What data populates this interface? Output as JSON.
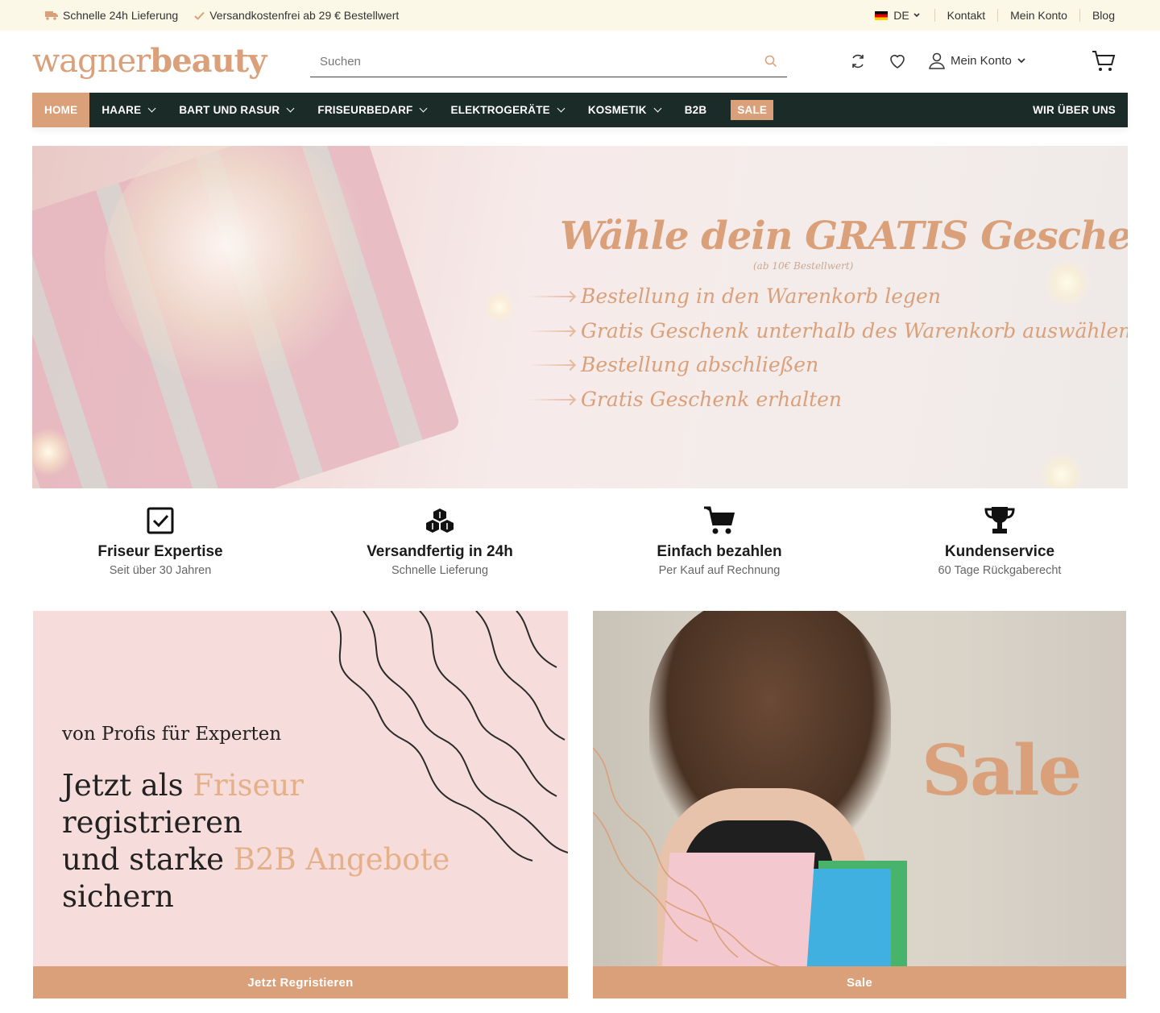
{
  "topbar": {
    "shipping_fast": "Schnelle 24h Lieferung",
    "shipping_free": "Versandkostenfrei ab 29 € Bestellwert",
    "language": "DE",
    "links": [
      "Kontakt",
      "Mein Konto",
      "Blog"
    ]
  },
  "header": {
    "logo_light": "wagner",
    "logo_bold": "beauty",
    "search_placeholder": "Suchen",
    "account_label": "Mein Konto"
  },
  "nav": {
    "items": [
      {
        "label": "HOME",
        "dropdown": false
      },
      {
        "label": "HAARE",
        "dropdown": true
      },
      {
        "label": "BART UND RASUR",
        "dropdown": true
      },
      {
        "label": "FRISEURBEDARF",
        "dropdown": true
      },
      {
        "label": "ELEKTROGERÄTE",
        "dropdown": true
      },
      {
        "label": "KOSMETIK",
        "dropdown": true
      },
      {
        "label": "B2B",
        "dropdown": false
      },
      {
        "label": "SALE",
        "dropdown": false
      }
    ],
    "right_item": "WIR ÜBER UNS"
  },
  "hero": {
    "title": "Wähle dein GRATIS Geschenk",
    "subtitle": "(ab 10€ Bestellwert)",
    "steps": [
      "Bestellung in den Warenkorb legen",
      "Gratis Geschenk unterhalb des Warenkorb auswählen",
      "Bestellung abschließen",
      "Gratis Geschenk erhalten"
    ]
  },
  "features": [
    {
      "icon": "checkbox-icon",
      "title": "Friseur Expertise",
      "subtitle": "Seit über 30 Jahren"
    },
    {
      "icon": "boxes-icon",
      "title": "Versandfertig in 24h",
      "subtitle": "Schnelle Lieferung"
    },
    {
      "icon": "cart-icon",
      "title": "Einfach bezahlen",
      "subtitle": "Per Kauf auf Rechnung"
    },
    {
      "icon": "trophy-icon",
      "title": "Kundenservice",
      "subtitle": "60 Tage Rückgaberecht"
    }
  ],
  "banner_b2b": {
    "pre": "von Profis für Experten",
    "line1_a": "Jetzt als ",
    "line1_accent": "Friseur",
    "line1_b": " registrieren",
    "line2_a": "und starke ",
    "line2_accent": "B2B Angebote",
    "line3": "sichern",
    "button": "Jetzt Regristieren"
  },
  "banner_sale": {
    "headline": "Sale",
    "button": "Sale"
  },
  "colors": {
    "accent": "#d9a07a",
    "nav_bg": "#1b2b28",
    "topbar_bg": "#fbf8e7"
  }
}
